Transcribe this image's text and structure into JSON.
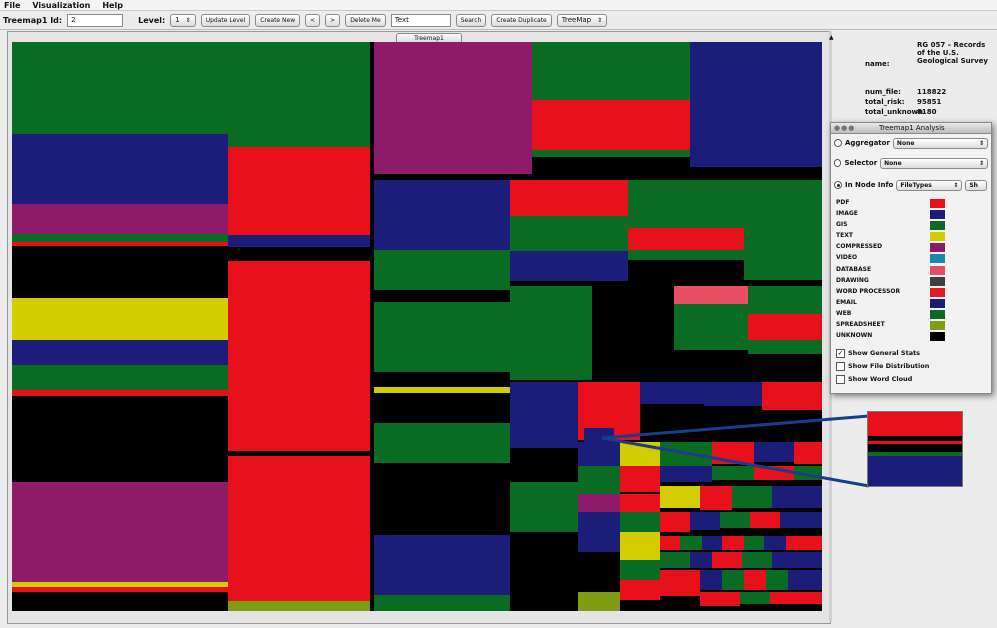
{
  "menu": {
    "file": "File",
    "visualization": "Visualization",
    "help": "Help"
  },
  "toolbar": {
    "treemap_id_label": "Treemap1 Id:",
    "treemap_id_value": "2",
    "level_label": "Level:",
    "level_value": "1",
    "update_level": "Update Level",
    "create_new": "Create New",
    "prev": "<",
    "next": ">",
    "delete_me": "Delete Me",
    "search_value": "Text",
    "search": "Search",
    "create_duplicate": "Create Duplicate",
    "view_select": "TreeMap"
  },
  "treemap": {
    "tab_label": "Treemap1"
  },
  "stats": {
    "name_label": "name:",
    "name_value": "RG 057 – Records of the U.S. Geological Survey",
    "num_file_label": "num_file:",
    "num_file_value": "118822",
    "total_risk_label": "total_risk:",
    "total_risk_value": "95851",
    "total_unknown_label": "total_unknown:",
    "total_unknown_value": "8180"
  },
  "analysis_panel": {
    "title": "Treemap1 Analysis",
    "aggregator_label": "Aggregator",
    "aggregator_value": "None",
    "selector_label": "Selector",
    "selector_value": "None",
    "in_node_label": "In Node Info",
    "in_node_value": "FileTypes",
    "extra_button": "Sh",
    "legend": [
      {
        "name": "PDF",
        "color": "#e8101a"
      },
      {
        "name": "IMAGE",
        "color": "#1c1d78"
      },
      {
        "name": "GIS",
        "color": "#0a6b23"
      },
      {
        "name": "TEXT",
        "color": "#d3cd00"
      },
      {
        "name": "COMPRESSED",
        "color": "#8d1b6a"
      },
      {
        "name": "VIDEO",
        "color": "#1b87a8"
      },
      {
        "name": "DATABASE",
        "color": "#e84f65"
      },
      {
        "name": "DRAWING",
        "color": "#3f3f40"
      },
      {
        "name": "WORD PROCESSOR",
        "color": "#e51b22"
      },
      {
        "name": "EMAIL",
        "color": "#1c1d78"
      },
      {
        "name": "WEB",
        "color": "#0a6b23"
      },
      {
        "name": "SPREADSHEET",
        "color": "#7e9d12"
      },
      {
        "name": "UNKNOWN",
        "color": "#000000"
      }
    ],
    "checkboxes": [
      {
        "label": "Show General Stats",
        "checked": true
      },
      {
        "label": "Show File Distribution",
        "checked": false
      },
      {
        "label": "Show Word Cloud",
        "checked": false
      }
    ]
  },
  "colors": {
    "red": "#e8101a",
    "navy": "#1c1d78",
    "green": "#0a6b23",
    "yellow": "#d3cd00",
    "purple": "#8d1b6a",
    "pink": "#e84f65",
    "olive": "#7e9d12",
    "black": "#000000",
    "callout": "#1a3c8c"
  }
}
